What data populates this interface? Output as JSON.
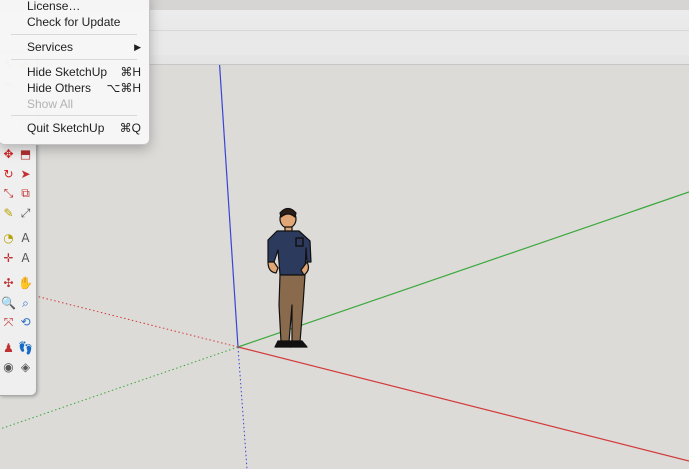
{
  "menu": {
    "items": [
      {
        "label": "License…",
        "shortcut": ""
      },
      {
        "label": "Check for Update",
        "shortcut": ""
      },
      {
        "label": "Services",
        "shortcut": "▶"
      },
      {
        "label": "Hide SketchUp",
        "shortcut": "⌘H"
      },
      {
        "label": "Hide Others",
        "shortcut": "⌥⌘H"
      },
      {
        "label": "Show All",
        "shortcut": ""
      },
      {
        "label": "Quit SketchUp",
        "shortcut": "⌘Q"
      }
    ]
  },
  "tools": [
    "select-tool-icon",
    "paint-bucket-icon",
    "eraser-icon",
    "line-tool-icon",
    "rectangle-tool-icon",
    "circle-tool-icon",
    "arc-tool-icon",
    "freehand-tool-icon",
    "move-tool-icon",
    "push-pull-tool-icon",
    "rotate-tool-icon",
    "follow-me-tool-icon",
    "scale-tool-icon",
    "offset-tool-icon",
    "tape-measure-icon",
    "dimension-tool-icon",
    "protractor-icon",
    "text-tool-icon",
    "axes-tool-icon",
    "3d-text-icon",
    "orbit-tool-icon",
    "pan-tool-icon",
    "zoom-tool-icon",
    "zoom-window-icon",
    "zoom-extents-icon",
    "previous-view-icon",
    "position-camera-icon",
    "walk-tool-icon",
    "look-around-icon",
    "section-plane-icon"
  ],
  "colors": {
    "x_axis": "#d43a3a",
    "y_axis": "#3ba83b",
    "z_axis": "#3a45d4",
    "background": "#dcdbd8"
  }
}
